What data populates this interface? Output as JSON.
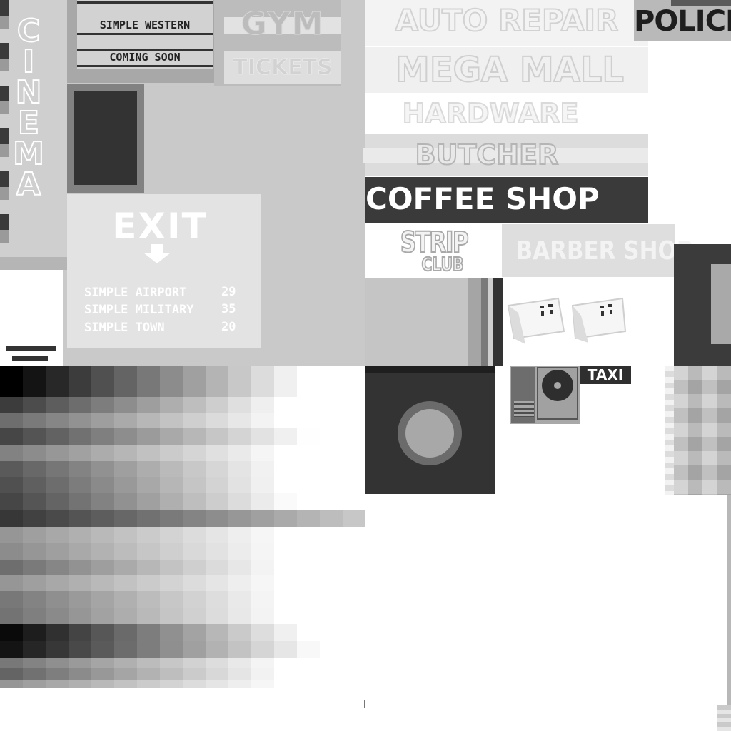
{
  "atlas": {
    "cinema": {
      "letters": "CINEMA"
    },
    "marquee": {
      "line1": "SIMPLE WESTERN",
      "line2": "COMING SOON"
    },
    "gym": {
      "label": "GYM",
      "tickets": "TICKETS"
    },
    "exit_sign": {
      "title": "EXIT",
      "destinations": [
        {
          "name": "SIMPLE AIRPORT",
          "distance": "29"
        },
        {
          "name": "SIMPLE MILITARY",
          "distance": "35"
        },
        {
          "name": "SIMPLE TOWN",
          "distance": "20"
        }
      ]
    },
    "signs": {
      "auto_repair": "AUTO REPAIR",
      "police": "POLICE",
      "mega_mall": "MEGA MALL",
      "hardware": "HARDWARE",
      "butcher": "BUTCHER",
      "coffee_shop": "COFFEE SHOP",
      "strip": "STRIP",
      "club": "CLUB",
      "barber_shop": "BARBER SHOP",
      "taxi": "TAXI"
    },
    "icons": [
      "robot-face-icon",
      "robot-face-icon",
      "speaker-icon",
      "knob-icon",
      "down-arrow-icon"
    ],
    "gradient": {
      "description_colors": [
        "#000000",
        "#ffffff"
      ],
      "rows": [
        {
          "start": 0,
          "end": 240,
          "h": 44
        },
        {
          "start": 60,
          "end": 255,
          "h": 22
        },
        {
          "start": 110,
          "end": 255,
          "h": 22
        },
        {
          "start": 70,
          "end": 240,
          "h": 24
        },
        {
          "start": 130,
          "end": 255,
          "h": 22
        },
        {
          "start": 90,
          "end": 255,
          "h": 22
        },
        {
          "start": 80,
          "end": 255,
          "h": 22
        },
        {
          "start": 70,
          "end": 250,
          "h": 24
        },
        {
          "start": 55,
          "end": 170,
          "h": 24
        },
        {
          "start": 150,
          "end": 255,
          "h": 22
        },
        {
          "start": 140,
          "end": 255,
          "h": 24
        },
        {
          "start": 110,
          "end": 255,
          "h": 22
        },
        {
          "start": 150,
          "end": 255,
          "h": 22
        },
        {
          "start": 120,
          "end": 255,
          "h": 24
        },
        {
          "start": 115,
          "end": 255,
          "h": 22
        },
        {
          "start": 10,
          "end": 240,
          "h": 24
        },
        {
          "start": 20,
          "end": 230,
          "h": 24
        },
        {
          "start": 120,
          "end": 255,
          "h": 14
        },
        {
          "start": 100,
          "end": 255,
          "h": 16
        },
        {
          "start": 150,
          "end": 255,
          "h": 12
        }
      ]
    }
  }
}
